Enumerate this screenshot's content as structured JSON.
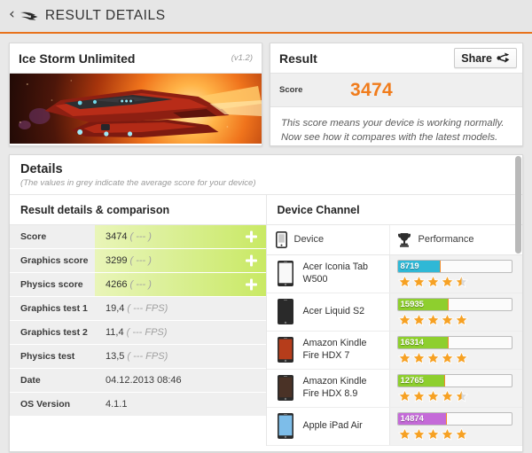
{
  "topbar": {
    "back_icon": "back-chevron-icon",
    "logo_icon": "3dmark-swoosh-logo-icon",
    "title": "RESULT DETAILS"
  },
  "test_card": {
    "name": "Ice Storm Unlimited",
    "version": "(v1.2)",
    "hero_image_alt": "spaceship-artwork"
  },
  "result_card": {
    "title": "Result",
    "share_label": "Share",
    "share_icon": "share-nodes-icon",
    "score_label": "Score",
    "score_value": "3474",
    "note_line1": "This score means your device is working normally.",
    "note_line2": "Now see how it compares with the latest models."
  },
  "details": {
    "title": "Details",
    "subtitle": "(The values in grey indicate the average score for your device)",
    "left_header": "Result details & comparison",
    "right_header": "Device Channel",
    "rows": [
      {
        "key": "Score",
        "value": "3474",
        "grey": "( --- )",
        "highlight": true
      },
      {
        "key": "Graphics score",
        "value": "3299",
        "grey": "( --- )",
        "highlight": true
      },
      {
        "key": "Physics score",
        "value": "4266",
        "grey": "( --- )",
        "highlight": true
      },
      {
        "key": "Graphics test 1",
        "value": "19,4",
        "grey": "( --- FPS)",
        "highlight": false
      },
      {
        "key": "Graphics test 2",
        "value": "11,4",
        "grey": "( --- FPS)",
        "highlight": false
      },
      {
        "key": "Physics test",
        "value": "13,5",
        "grey": "( --- FPS)",
        "highlight": false
      },
      {
        "key": "Date",
        "value": "04.12.2013 08:46",
        "grey": "",
        "highlight": false
      },
      {
        "key": "OS Version",
        "value": "4.1.1",
        "grey": "",
        "highlight": false
      }
    ]
  },
  "device_channel": {
    "col_device_label": "Device",
    "col_device_icon": "phone-icon",
    "col_perf_label": "Performance",
    "col_perf_icon": "trophy-icon",
    "devices": [
      {
        "name": "Acer Iconia Tab W500",
        "score": "8719",
        "fill_pct": 38,
        "color": "#2fb8d6",
        "stars": 4.5,
        "thumb": "tablet-thumb"
      },
      {
        "name": "Acer Liquid S2",
        "score": "15935",
        "fill_pct": 45,
        "color": "#8ecf2e",
        "stars": 5,
        "thumb": "phone-thumb"
      },
      {
        "name": "Amazon Kindle Fire HDX 7",
        "score": "16314",
        "fill_pct": 45,
        "color": "#8ecf2e",
        "stars": 5,
        "thumb": "kindle7-thumb"
      },
      {
        "name": "Amazon Kindle Fire HDX 8.9",
        "score": "12765",
        "fill_pct": 42,
        "color": "#8ecf2e",
        "stars": 4.5,
        "thumb": "kindle89-thumb"
      },
      {
        "name": "Apple iPad Air",
        "score": "14874",
        "fill_pct": 43,
        "color": "#c46ad8",
        "stars": 5,
        "thumb": "ipad-thumb"
      }
    ]
  },
  "colors": {
    "accent_orange": "#e8721c",
    "score_orange": "#f07c1c",
    "green_bar": "#8ecf2e",
    "cyan_bar": "#2fb8d6",
    "purple_bar": "#c46ad8",
    "star_fill": "#f6a124"
  }
}
